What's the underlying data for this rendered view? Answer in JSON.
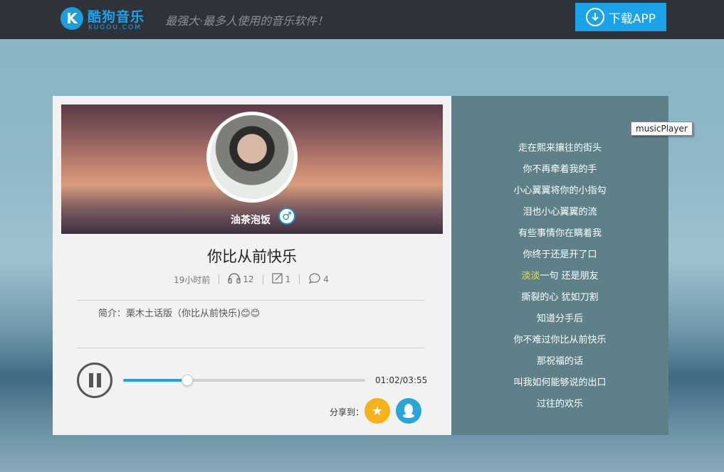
{
  "header": {
    "logo_text": "酷狗音乐",
    "logo_sub": "KUGOU.COM",
    "logo_mark": "K",
    "slogan": "最强大·最多人使用的音乐软件！",
    "download_label": "下载APP"
  },
  "profile": {
    "username": "油茶泡饭",
    "gender_icon": "♂"
  },
  "song": {
    "title": "你比从前快乐",
    "time_ago": "19小时前",
    "listens": "12",
    "shares": "1",
    "comments": "4",
    "intro": "简介：栗木土话版（你比从前快乐)😊😊"
  },
  "player": {
    "time_display": "01:02/03:55",
    "progress_fraction": 0.265
  },
  "share": {
    "label": "分享到："
  },
  "lyrics": [
    "走在熙来攘往的街头",
    "你不再牵着我的手",
    "小心翼翼将你的小指勾",
    "泪也小心翼翼的流",
    "有些事情你在瞒着我",
    "你终于还是开了口",
    "淡淡一句 还是朋友",
    "撕裂的心 犹如刀割",
    "知道分手后",
    "你不难过你比从前快乐",
    "那祝福的话",
    "叫我如何能够说的出口",
    "过往的欢乐"
  ],
  "lyric_highlight": {
    "line_index": 6,
    "highlighted_text": "淡淡"
  },
  "tooltip": "musicPlayer",
  "colors": {
    "accent": "#1aa3e8",
    "topbar": "#2f3339",
    "lyrics_panel": "#5e8189",
    "lyric_highlight": "#f6e34a"
  }
}
